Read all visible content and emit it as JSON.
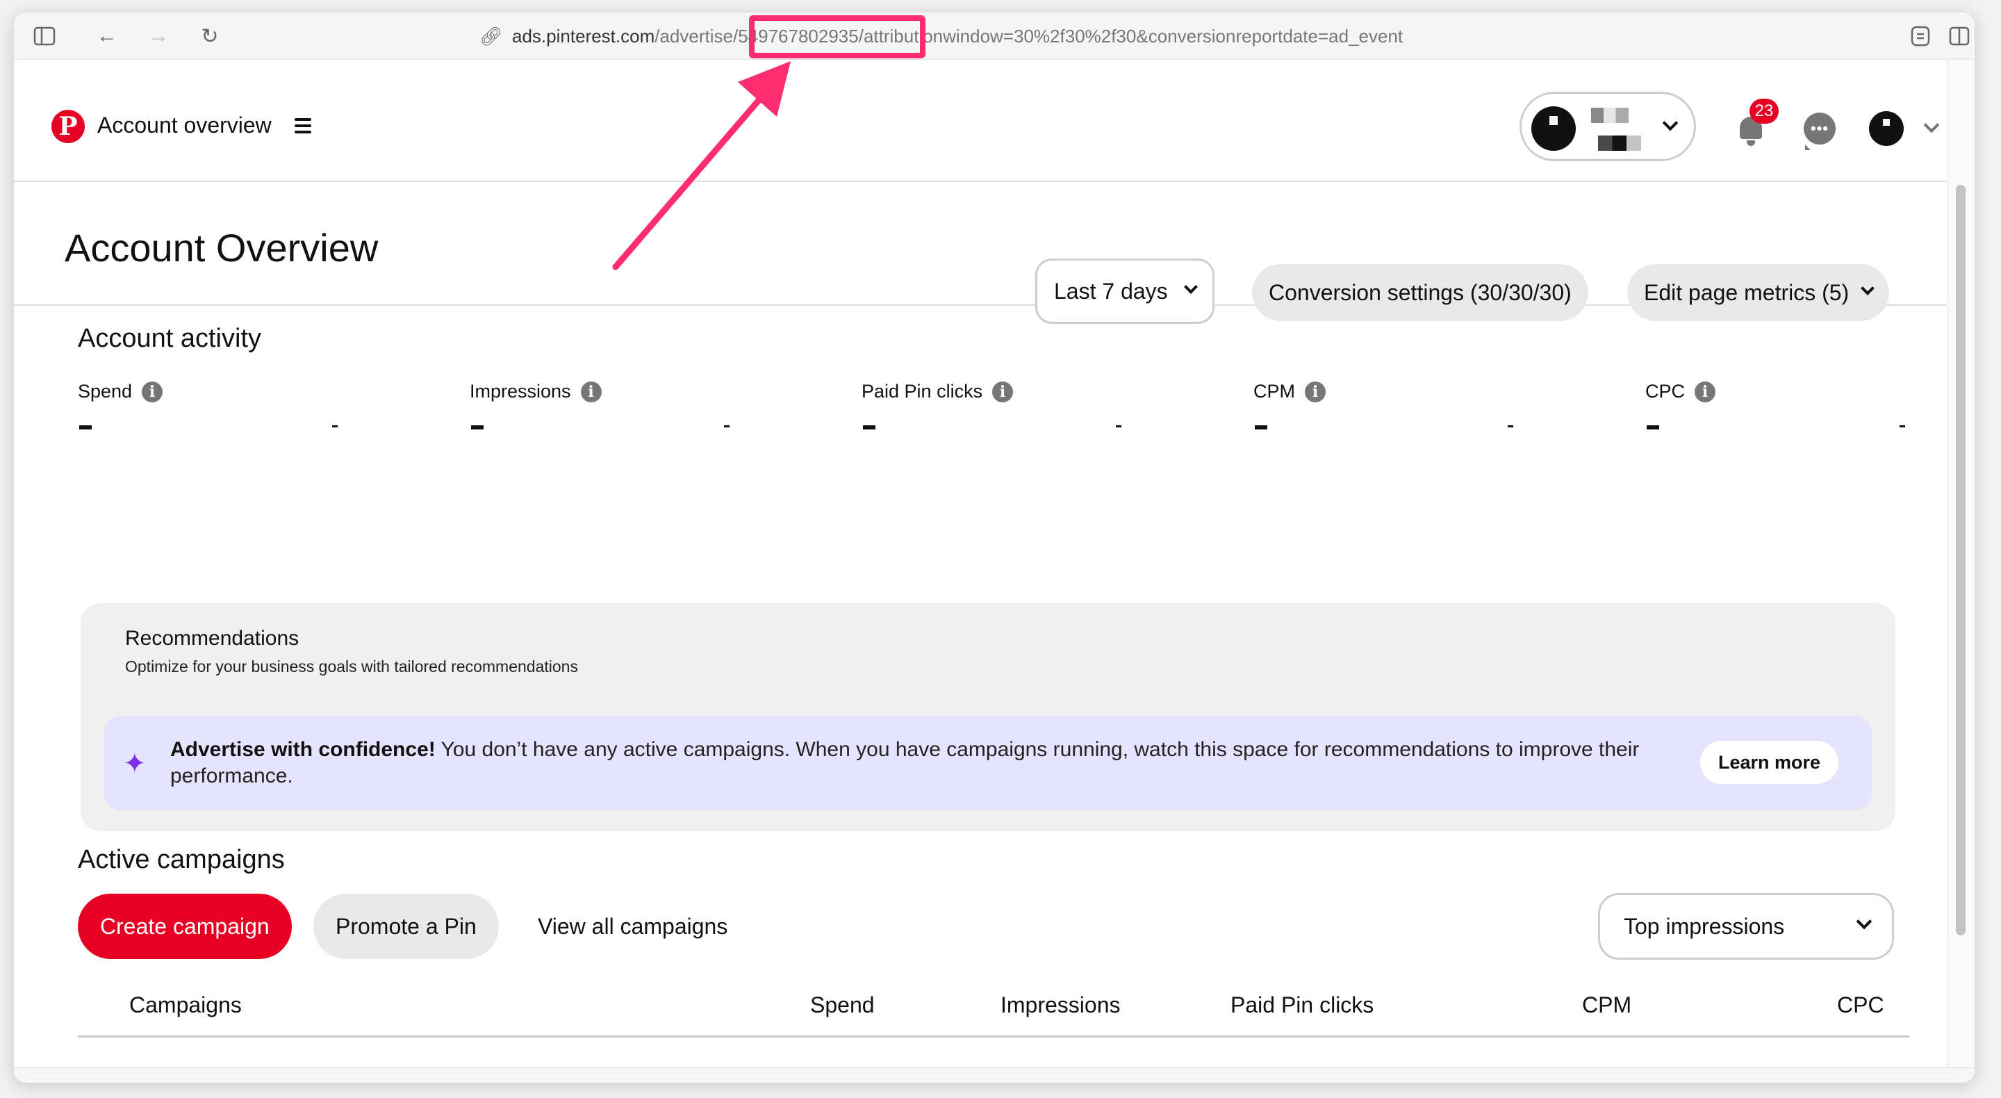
{
  "browser": {
    "url_host": "ads.pinterest.com",
    "url_path_before": "/advertise",
    "url_highlighted": "/549767802935/",
    "url_path_after": "attributionwindow=30%2f30%2f30&conversionreportdate=ad_event",
    "highlight_color": "#ff2d6f"
  },
  "header": {
    "title": "Account overview",
    "notification_count": "23",
    "chat_dots": "•••"
  },
  "page": {
    "title": "Account Overview",
    "date_range": "Last 7 days",
    "conversion_settings": "Conversion settings (30/30/30)",
    "edit_metrics": "Edit page metrics (5)"
  },
  "activity": {
    "title": "Account activity",
    "metrics": [
      {
        "label": "Spend",
        "value": "-",
        "delta": "-"
      },
      {
        "label": "Impressions",
        "value": "-",
        "delta": "-"
      },
      {
        "label": "Paid Pin clicks",
        "value": "-",
        "delta": "-"
      },
      {
        "label": "CPM",
        "value": "-",
        "delta": "-"
      },
      {
        "label": "CPC",
        "value": "-",
        "delta": "-"
      }
    ]
  },
  "recommendations": {
    "title": "Recommendations",
    "subtitle": "Optimize for your business goals with tailored recommendations",
    "banner_bold": "Advertise with confidence!",
    "banner_text": " You don’t have any active campaigns. When you have campaigns running, watch this space for recommendations to improve their performance.",
    "learn_more": "Learn more"
  },
  "campaigns": {
    "title": "Active campaigns",
    "create": "Create campaign",
    "promote": "Promote a Pin",
    "view_all": "View all campaigns",
    "sort": "Top impressions",
    "columns": [
      "Campaigns",
      "Spend",
      "Impressions",
      "Paid Pin clicks",
      "CPM",
      "CPC"
    ]
  },
  "colors": {
    "brand_red": "#e60023",
    "banner_purple": "#e6e3fe",
    "sparkle": "#7c2ee8"
  }
}
